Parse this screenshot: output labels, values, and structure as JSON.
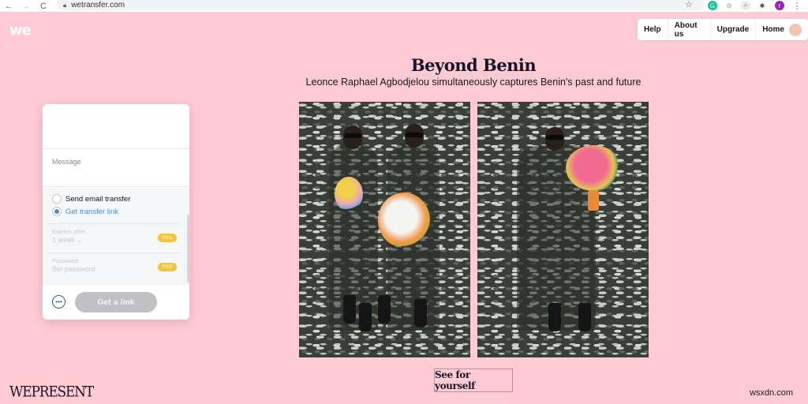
{
  "browser": {
    "url": "wetransfer.com",
    "back_icon": "←",
    "forward_icon": "→",
    "reload_icon": "C",
    "bookmark_icon": "☆",
    "extensions": [
      {
        "name": "grammarly",
        "glyph": "G",
        "color": "#15c39a"
      },
      {
        "name": "settings-extension",
        "glyph": "⚙",
        "color": "#bdbdbd"
      },
      {
        "name": "search-extension",
        "glyph": "⌕",
        "color": "#e0e0e0"
      },
      {
        "name": "puzzle",
        "glyph": "✱",
        "color": "#444444"
      },
      {
        "name": "profile",
        "glyph": "r",
        "color": "#9c27b0"
      }
    ],
    "menu_icon": "⋮"
  },
  "site": {
    "logo": "we",
    "nav": [
      {
        "label": "Help"
      },
      {
        "label": "About us"
      },
      {
        "label": "Upgrade"
      },
      {
        "label": "Home"
      }
    ]
  },
  "transfer_card": {
    "message_placeholder": "Message",
    "options": [
      {
        "label": "Send email transfer",
        "checked": false
      },
      {
        "label": "Get transfer link",
        "checked": true
      }
    ],
    "expires": {
      "label": "Expires after",
      "value": "1 week ⌄",
      "badge": "PRO"
    },
    "password": {
      "label": "Password",
      "placeholder": "Set password",
      "badge": "PRO"
    },
    "more_icon": "•••",
    "submit_label": "Get a link"
  },
  "article": {
    "title": "Beyond Benin",
    "subtitle": "Leonce Raphael Agbodjelou simultaneously captures Benin's past and future",
    "cta_label": "See for yourself",
    "brand": "WEPRESENT"
  },
  "watermark": "wsxdn.com",
  "colors": {
    "background": "#fdcbd3",
    "accent_blue": "#4a8fd6",
    "pro_badge": "#f3c53a"
  }
}
